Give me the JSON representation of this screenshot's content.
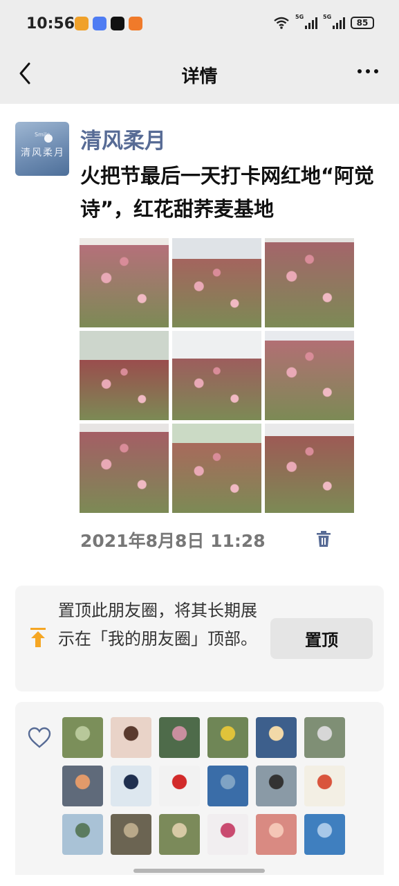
{
  "status_bar": {
    "time": "10:56",
    "network_tags": [
      "5G",
      "5G"
    ],
    "battery": "85",
    "notification_icons": [
      {
        "name": "mango-tv-app-icon",
        "color": "#f0a12a"
      },
      {
        "name": "messaging-app-icon",
        "color": "#4e7cf3"
      },
      {
        "name": "tiktok-app-icon",
        "color": "#111111"
      },
      {
        "name": "orange-app-icon",
        "color": "#f07a2a"
      }
    ]
  },
  "nav": {
    "title": "详情",
    "back_icon": "chevron-left-icon",
    "more_icon": "more-dots-icon"
  },
  "post": {
    "user_name": "清风柔月",
    "avatar_text": "清风柔月",
    "avatar_small_text": "Smile",
    "text": "火把节最后一天打卡网红地“阿觉诗”，红花甜荞麦基地",
    "time": "2021年8月8日 11:28",
    "photos": [
      {
        "name": "photo-1",
        "sky": "#eeeae6",
        "field": "#b5707a",
        "skyh": 10
      },
      {
        "name": "photo-2",
        "sky": "#dfe3e7",
        "field": "#a4645e",
        "skyh": 30
      },
      {
        "name": "photo-3",
        "sky": "#e3e2df",
        "field": "#a4656a",
        "skyh": 6
      },
      {
        "name": "photo-4",
        "sky": "#cdd6cc",
        "field": "#9a4d4d",
        "skyh": 42
      },
      {
        "name": "photo-5",
        "sky": "#eef0f1",
        "field": "#9d5d5d",
        "skyh": 40
      },
      {
        "name": "photo-6",
        "sky": "#e8eaee",
        "field": "#b26f74",
        "skyh": 14
      },
      {
        "name": "photo-7",
        "sky": "#e7e4e3",
        "field": "#a45e65",
        "skyh": 12
      },
      {
        "name": "photo-8",
        "sky": "#cbdac5",
        "field": "#a86a5c",
        "skyh": 28
      },
      {
        "name": "photo-9",
        "sky": "#e9e9ea",
        "field": "#9d5a55",
        "skyh": 18
      }
    ]
  },
  "pin": {
    "text": "置顶此朋友圈，将其长期展示在「我的朋友圈」顶部。",
    "button_label": "置顶",
    "icon": "pin-to-top-icon",
    "icon_color": "#f5a623"
  },
  "likes": {
    "icon": "heart-outline-icon",
    "accent": "#576b95",
    "avatars": [
      {
        "bg": "#7b8f5a",
        "fg": "#b8c89a"
      },
      {
        "bg": "#e9d3c8",
        "fg": "#5a3a2e"
      },
      {
        "bg": "#4e6b4a",
        "fg": "#c98f9f"
      },
      {
        "bg": "#6f8656",
        "fg": "#e0c33a"
      },
      {
        "bg": "#3d5f8c",
        "fg": "#f2d9a8"
      },
      {
        "bg": "#7f8f75",
        "fg": "#d7d7d7"
      },
      {
        "bg": "#5f6a7a",
        "fg": "#e29a6a"
      },
      {
        "bg": "#dde7ef",
        "fg": "#1f2f4f"
      },
      {
        "bg": "#f2f2f2",
        "fg": "#d22a2a"
      },
      {
        "bg": "#3a6da8",
        "fg": "#7fa3c4"
      },
      {
        "bg": "#8a9aa6",
        "fg": "#333333"
      },
      {
        "bg": "#f3efe4",
        "fg": "#d9553d"
      },
      {
        "bg": "#a9c2d6",
        "fg": "#5b7b5f"
      },
      {
        "bg": "#6b6452",
        "fg": "#b9a98a"
      },
      {
        "bg": "#7b8a5a",
        "fg": "#d7c9a5"
      },
      {
        "bg": "#f1eef0",
        "fg": "#c94b70"
      },
      {
        "bg": "#d98a82",
        "fg": "#f4c6b6"
      },
      {
        "bg": "#3f7fbf",
        "fg": "#a8c8e8"
      }
    ]
  }
}
